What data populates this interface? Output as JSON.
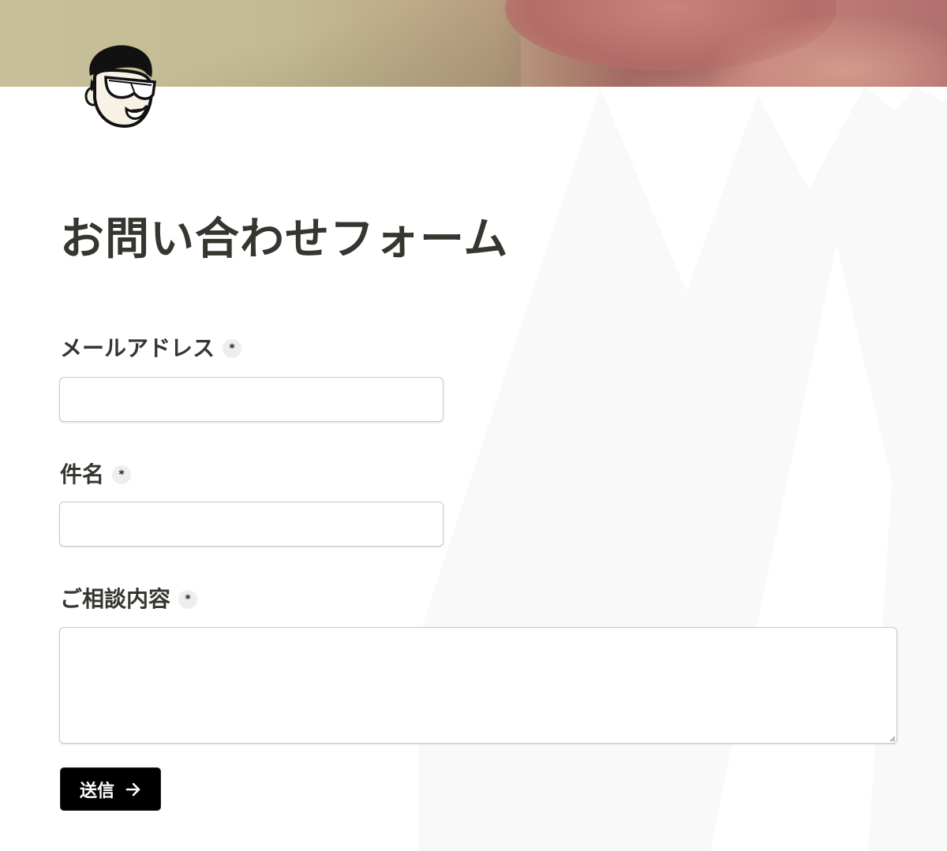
{
  "form": {
    "title": "お問い合わせフォーム",
    "required_mark": "*",
    "fields": [
      {
        "label": "メールアドレス",
        "value": "",
        "required": true
      },
      {
        "label": "件名",
        "value": "",
        "required": true
      },
      {
        "label": "ご相談内容",
        "value": "",
        "required": true
      }
    ],
    "submit_label": "送信",
    "submit_icon": "arrow-right-icon"
  },
  "header": {
    "avatar": "cartoon-face-with-goggles-icon"
  },
  "colors": {
    "text": "#37352f",
    "button_bg": "#000000",
    "button_text": "#ffffff",
    "badge_bg": "#eeeeee",
    "border": "#c9c9c9"
  }
}
